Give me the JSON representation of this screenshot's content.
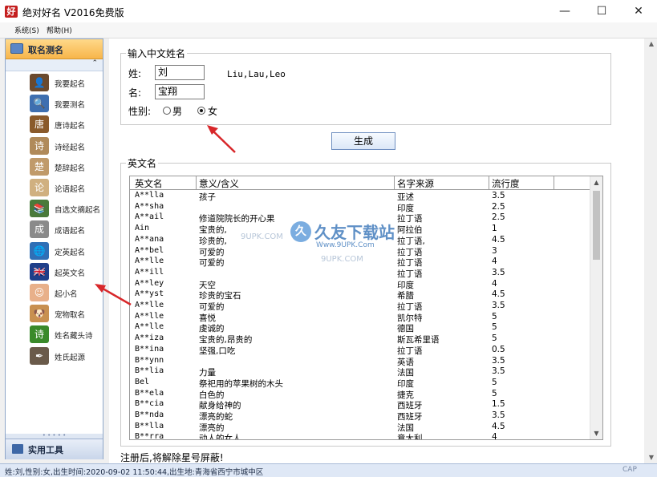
{
  "window": {
    "app_icon_glyph": "好",
    "title": "绝对好名 V2016免费版",
    "minimize_glyph": "—",
    "maximize_glyph": "☐",
    "close_glyph": "✕"
  },
  "menu": {
    "items": [
      {
        "label": "系统(S)"
      },
      {
        "label": "帮助(H)"
      }
    ]
  },
  "sidebar": {
    "header_label": "取名测名",
    "collapse_glyph": "⌃",
    "items": [
      {
        "label": "我要起名",
        "icon": "person-icon",
        "color": "#6b4a2e",
        "glyph": "👤"
      },
      {
        "label": "我要测名",
        "icon": "magnifier-icon",
        "color": "#3e6fb0",
        "glyph": "🔍"
      },
      {
        "label": "唐诗起名",
        "icon": "tang-seal-icon",
        "color": "#8a5a2b",
        "glyph": "唐"
      },
      {
        "label": "诗经起名",
        "icon": "scroll-icon",
        "color": "#b08a5a",
        "glyph": "诗"
      },
      {
        "label": "楚辞起名",
        "icon": "calligraphy-icon",
        "color": "#c09a6a",
        "glyph": "楚"
      },
      {
        "label": "论语起名",
        "icon": "scroll-icon",
        "color": "#d0b080",
        "glyph": "论"
      },
      {
        "label": "自选文摘起名",
        "icon": "books-icon",
        "color": "#4a7a3a",
        "glyph": "📚"
      },
      {
        "label": "成语起名",
        "icon": "book-icon",
        "color": "#8a8a8a",
        "glyph": "成"
      },
      {
        "label": "定英起名",
        "icon": "globe-icon",
        "color": "#2f6fb6",
        "glyph": "🌐"
      },
      {
        "label": "起英文名",
        "icon": "uk-flag-icon",
        "color": "#1f3f8a",
        "glyph": "🇬🇧"
      },
      {
        "label": "起小名",
        "icon": "baby-icon",
        "color": "#e8b08a",
        "glyph": "☺"
      },
      {
        "label": "宠物取名",
        "icon": "dog-icon",
        "color": "#c89050",
        "glyph": "🐶"
      },
      {
        "label": "姓名藏头诗",
        "icon": "poem-icon",
        "color": "#3a8a2a",
        "glyph": "诗"
      },
      {
        "label": "姓氏起源",
        "icon": "quill-icon",
        "color": "#6a5a4a",
        "glyph": "✒"
      }
    ],
    "grip": "• • • • •",
    "util_label": "实用工具"
  },
  "form": {
    "group_title": "输入中文姓名",
    "surname_label": "姓:",
    "surname_value": "刘",
    "surname_hint": "Liu,Lau,Leo",
    "given_label": "名:",
    "given_value": "宝翔",
    "gender_label": "性别:",
    "male_label": "男",
    "female_label": "女",
    "gender_selected": "女",
    "generate_label": "生成"
  },
  "results": {
    "group_title": "英文名",
    "columns": [
      "英文名",
      "意义/含义",
      "名字来源",
      "流行度"
    ],
    "rows": [
      [
        "A**lla",
        "孩子",
        "亚述",
        "3.5"
      ],
      [
        "A**sha",
        "",
        "印度",
        "2.5"
      ],
      [
        "A**ail",
        "修道院院长的开心果",
        "拉丁语",
        "2.5"
      ],
      [
        "Ain",
        "宝贵的,",
        "阿拉伯",
        "1"
      ],
      [
        "A**ana",
        "珍贵的,",
        "拉丁语,",
        "4.5"
      ],
      [
        "A**bel",
        "可爱的",
        "拉丁语",
        "3"
      ],
      [
        "A**lle",
        "可爱的",
        "拉丁语",
        "4"
      ],
      [
        "A**ill",
        "",
        "拉丁语",
        "3.5"
      ],
      [
        "A**ley",
        "天空",
        "印度",
        "4"
      ],
      [
        "A**yst",
        "珍贵的宝石",
        "希腊",
        "4.5"
      ],
      [
        "A**lle",
        "可爱的",
        "拉丁语",
        "3.5"
      ],
      [
        "A**lle",
        "喜悦",
        "凯尔特",
        "5"
      ],
      [
        "A**lle",
        "虔诚的",
        "德国",
        "5"
      ],
      [
        "A**iza",
        "宝贵的,昂贵的",
        "斯瓦希里语",
        "5"
      ],
      [
        "B**ina",
        "坚强,口吃",
        "拉丁语",
        "0.5"
      ],
      [
        "B**ynn",
        "",
        "英语",
        "3.5"
      ],
      [
        "B**lia",
        "力量",
        "法国",
        "3.5"
      ],
      [
        "Bel",
        "祭祀用的苹果树的木头",
        "印度",
        "5"
      ],
      [
        "B**ela",
        "白色的",
        "捷克",
        "5"
      ],
      [
        "B**cia",
        "献身给神的",
        "西班牙",
        "1.5"
      ],
      [
        "B**nda",
        "漂亮的蛇",
        "西班牙",
        "3.5"
      ],
      [
        "B**lla",
        "漂亮的",
        "法国",
        "4.5"
      ],
      [
        "B**rra",
        "动人的女人",
        "意大利",
        "4"
      ]
    ],
    "scroll_up": "▲",
    "scroll_down": "▼"
  },
  "notice": "注册后,将解除星号屏蔽!",
  "watermark": {
    "badge": "久",
    "title": "久友下载站",
    "url": "Www.9UPK.Com",
    "faint1": "9UPK.COM",
    "faint2": "9UPK.COM"
  },
  "statusbar": {
    "text": "姓:刘,性别:女,出生时间:2020-09-02 11:50:44,出生地:青海省西宁市城中区",
    "cap": "CAP"
  },
  "outer_scroll": {
    "up": "▲",
    "down": "▼"
  },
  "colors": {
    "accent_orange": "#f7b54a",
    "nav_blue": "#8fa6c9",
    "status_blue": "#dfe8f6"
  }
}
